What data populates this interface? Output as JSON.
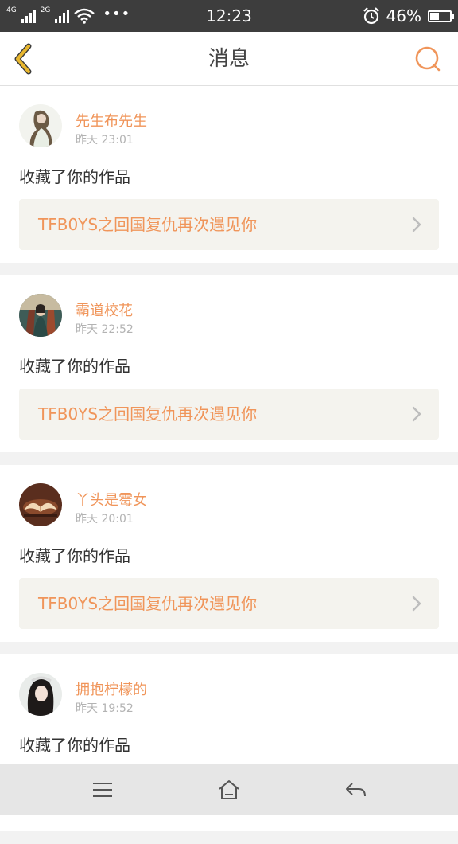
{
  "status_bar": {
    "network_1": "4G",
    "network_2": "2G",
    "time": "12:23",
    "battery_text": "46%",
    "battery_level": 0.46
  },
  "header": {
    "title": "消息",
    "back_icon": "chevron-left-icon",
    "search_icon": "search-icon"
  },
  "colors": {
    "accent": "#f0955a",
    "back_arrow": "#e8b72f",
    "work_bg": "#f4f3ee"
  },
  "messages": [
    {
      "user": "先生布先生",
      "time": "昨天 23:01",
      "action": "收藏了你的作品",
      "work_title": "TFB0YS之回国复仇再次遇见你"
    },
    {
      "user": "霸道校花",
      "time": "昨天 22:52",
      "action": "收藏了你的作品",
      "work_title": "TFB0YS之回国复仇再次遇见你"
    },
    {
      "user": "丫头是霉女",
      "time": "昨天 20:01",
      "action": "收藏了你的作品",
      "work_title": "TFB0YS之回国复仇再次遇见你"
    },
    {
      "user": "拥抱柠檬的",
      "time": "昨天 19:52",
      "action": "收藏了你的作品"
    }
  ],
  "nav": {
    "menu_icon": "menu-icon",
    "home_icon": "home-icon",
    "back_icon": "back-arrow-icon"
  }
}
